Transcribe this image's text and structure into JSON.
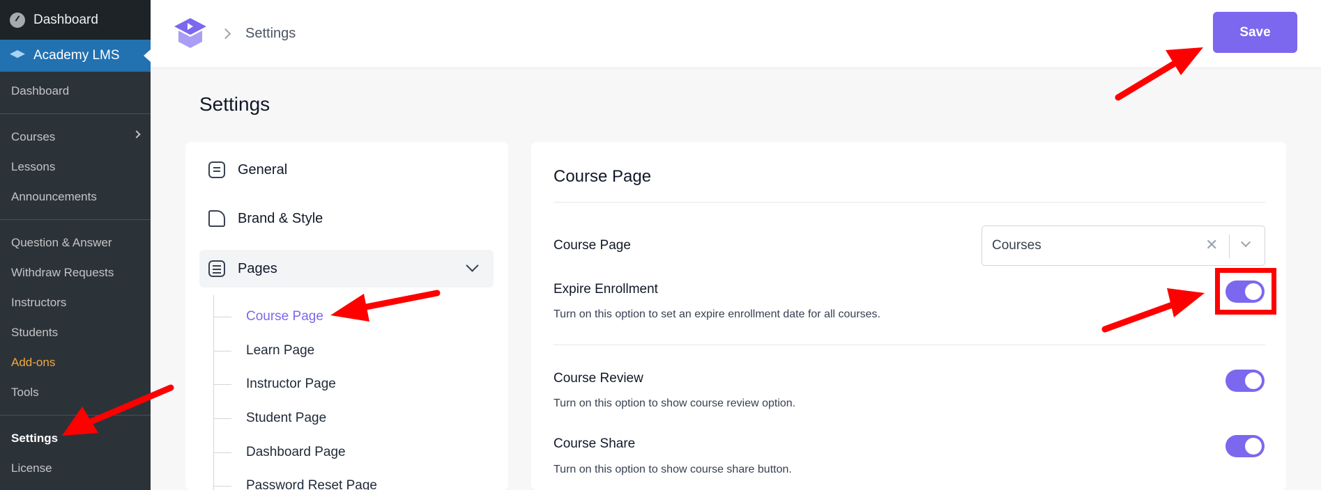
{
  "wp_sidebar": {
    "top_item": "Dashboard",
    "active_item": "Academy LMS",
    "submenu": [
      {
        "label": "Dashboard"
      },
      {
        "label": "Courses"
      },
      {
        "label": "Lessons"
      },
      {
        "label": "Announcements"
      },
      {
        "label": "Question & Answer"
      },
      {
        "label": "Withdraw Requests"
      },
      {
        "label": "Instructors"
      },
      {
        "label": "Students"
      },
      {
        "label": "Add-ons"
      },
      {
        "label": "Tools"
      },
      {
        "label": "Settings"
      },
      {
        "label": "License"
      }
    ]
  },
  "header": {
    "breadcrumb": "Settings",
    "save_label": "Save"
  },
  "page_title": "Settings",
  "settings_nav": {
    "items": [
      {
        "label": "General",
        "icon": "general-icon"
      },
      {
        "label": "Brand & Style",
        "icon": "brand-style-icon"
      },
      {
        "label": "Pages",
        "icon": "pages-icon"
      }
    ],
    "pages_sub": [
      {
        "label": "Course Page"
      },
      {
        "label": "Learn Page"
      },
      {
        "label": "Instructor Page"
      },
      {
        "label": "Student Page"
      },
      {
        "label": "Dashboard Page"
      },
      {
        "label": "Password Reset Page"
      }
    ]
  },
  "content": {
    "title": "Course Page",
    "course_page": {
      "label": "Course Page",
      "value": "Courses"
    },
    "expire_enrollment": {
      "label": "Expire Enrollment",
      "desc": "Turn on this option to set an expire enrollment date for all courses.",
      "on": true
    },
    "course_review": {
      "label": "Course Review",
      "desc": "Turn on this option to show course review option.",
      "on": true
    },
    "course_share": {
      "label": "Course Share",
      "desc": "Turn on this option to show course share button.",
      "on": true
    }
  },
  "colors": {
    "accent": "#7b68ee",
    "wp_blue": "#2271b1",
    "annotation": "#ff0000"
  }
}
